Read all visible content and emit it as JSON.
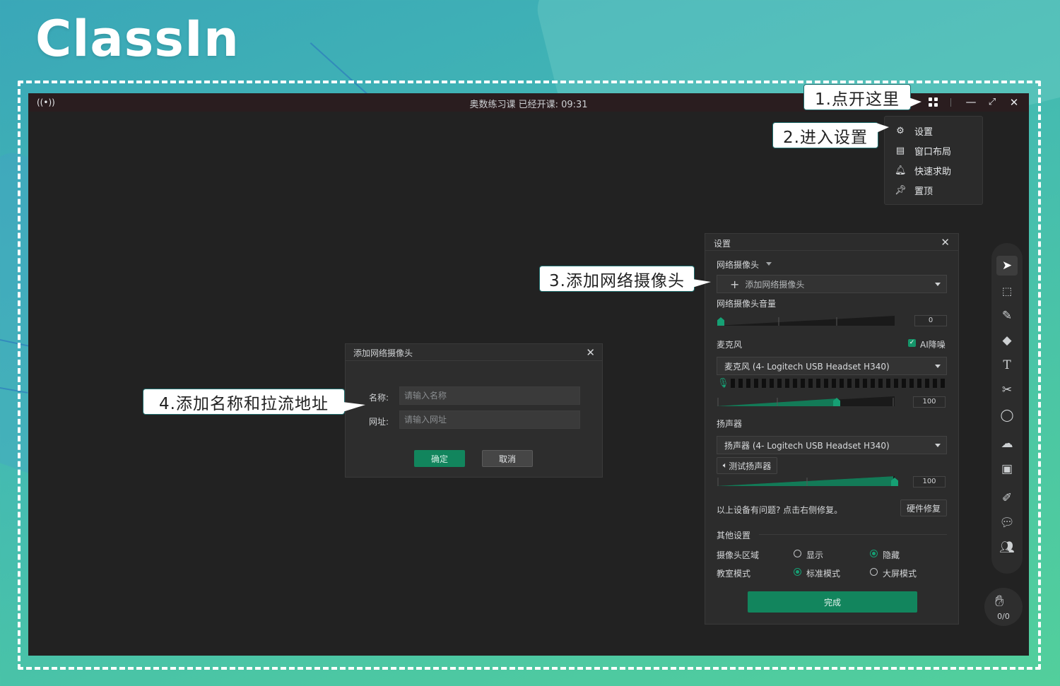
{
  "brand": {
    "logo": "ClassIn"
  },
  "window": {
    "title": "奥数练习课    已经开课: 09:31",
    "controls": [
      "grid-menu",
      "minimize",
      "restore",
      "close"
    ]
  },
  "menu": {
    "items": [
      {
        "icon": "gear-icon",
        "label": "设置"
      },
      {
        "icon": "layout-icon",
        "label": "窗口布局"
      },
      {
        "icon": "bell-icon",
        "label": "快速求助"
      },
      {
        "icon": "pin-icon",
        "label": "置顶"
      }
    ]
  },
  "callouts": {
    "step1": "1.点开这里",
    "step2": "2.进入设置",
    "step3": "3.添加网络摄像头",
    "step4": "4.添加名称和拉流地址"
  },
  "add_camera_dialog": {
    "title": "添加网络摄像头",
    "name_label": "名称:",
    "name_placeholder": "请输入名称",
    "url_label": "网址:",
    "url_placeholder": "请输入网址",
    "ok_label": "确定",
    "cancel_label": "取消"
  },
  "settings": {
    "title": "设置",
    "webcam_section": "网络摄像头",
    "webcam_dropdown": "添加网络摄像头",
    "webcam_volume_label": "网络摄像头音量",
    "webcam_volume": 0,
    "mic_label": "麦克风",
    "ai_noise": {
      "label": "AI降噪",
      "checked": true
    },
    "mic_device": "麦克风 (4- Logitech USB Headset H340)",
    "mic_volume": 100,
    "speaker_label": "扬声器",
    "speaker_device": "扬声器 (4- Logitech USB Headset H340)",
    "test_speaker_label": "测试扬声器",
    "speaker_volume": 100,
    "repair_hint": "以上设备有问题? 点击右侧修复。",
    "repair_button": "硬件修复",
    "other_section": "其他设置",
    "camera_area": {
      "label": "摄像头区域",
      "options": [
        "显示",
        "隐藏"
      ],
      "selected": "隐藏"
    },
    "classroom_mode": {
      "label": "教室模式",
      "options": [
        "标准模式",
        "大屏模式"
      ],
      "selected": "标准模式"
    },
    "done_label": "完成"
  },
  "toolbar": {
    "tools": [
      "cursor-icon",
      "select-area-icon",
      "pen-icon",
      "eraser-icon",
      "text-icon",
      "scissors-icon",
      "shape-icon",
      "cloud-icon",
      "toolbox-icon",
      "edit-icon",
      "chat-icon",
      "users-icon"
    ]
  },
  "hand_raise": {
    "count": "0/0"
  }
}
